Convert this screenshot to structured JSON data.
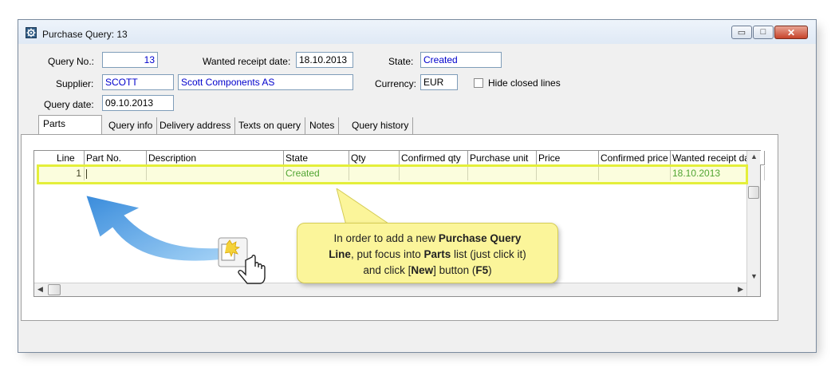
{
  "window": {
    "title": "Purchase Query: 13",
    "buttons": {
      "minimize": "▭",
      "maximize": "□",
      "close": "✕"
    }
  },
  "header": {
    "query_no": {
      "label": "Query No.:",
      "value": "13"
    },
    "wanted_receipt_date": {
      "label": "Wanted receipt date:",
      "value": "18.10.2013"
    },
    "state": {
      "label": "State:",
      "value": "Created"
    },
    "supplier": {
      "label": "Supplier:",
      "code": "SCOTT",
      "name": "Scott Components AS"
    },
    "currency": {
      "label": "Currency:",
      "value": "EUR"
    },
    "hide_closed_lines": {
      "label": "Hide closed lines",
      "checked": false
    },
    "query_date": {
      "label": "Query date:",
      "value": "09.10.2013"
    }
  },
  "tabs": [
    "Parts",
    "Query info",
    "Delivery address",
    "Texts on query",
    "Notes",
    "Query history"
  ],
  "grid": {
    "columns": [
      "Line",
      "Part No.",
      "Description",
      "State",
      "Qty",
      "Confirmed qty",
      "Purchase unit",
      "Price",
      "Confirmed price",
      "Wanted receipt date"
    ],
    "rows": [
      {
        "line": "1",
        "part_no": "",
        "description": "",
        "state": "Created",
        "qty": "",
        "confirmed_qty": "",
        "purchase_unit": "",
        "price": "",
        "confirmed_price": "",
        "wanted_receipt_date": "18.10.2013"
      }
    ]
  },
  "callout": {
    "parts": [
      {
        "t": "In order to add a new ",
        "b": false
      },
      {
        "t": "Purchase Query",
        "b": true
      },
      {
        "t": "Line",
        "b": true,
        "br": true
      },
      {
        "t": ", put focus into ",
        "b": false
      },
      {
        "t": "Parts",
        "b": true
      },
      {
        "t": " list (just click it)",
        "b": false
      },
      {
        "t": "and click [",
        "b": false,
        "br": true
      },
      {
        "t": "New",
        "b": true
      },
      {
        "t": "] button (",
        "b": false
      },
      {
        "t": "F5",
        "b": true
      },
      {
        "t": ")",
        "b": false
      }
    ]
  },
  "colors": {
    "highlight": "#e4ef3a",
    "callout_bg": "#fbf59a",
    "arrow": "#3f8fdc",
    "state_text": "#1c8a1c",
    "field_text": "#0000cc"
  }
}
